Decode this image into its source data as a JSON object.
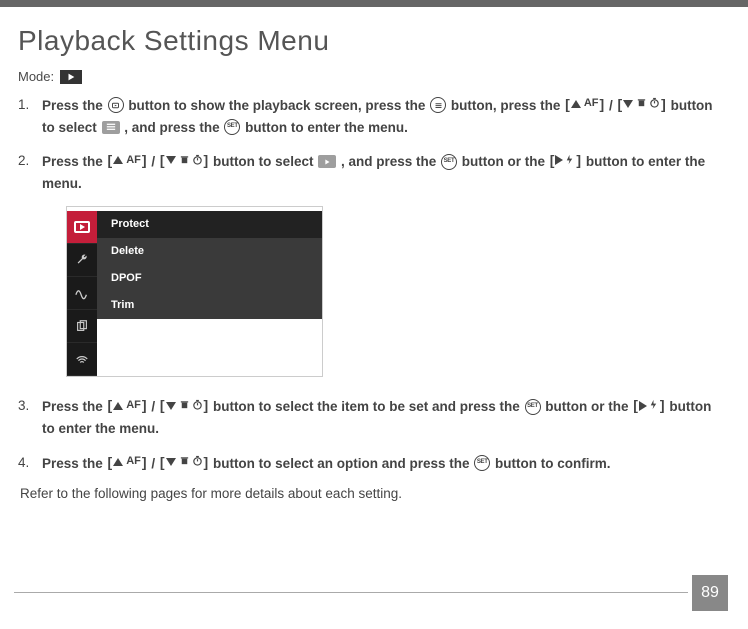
{
  "title": "Playback Settings Menu",
  "mode_label": "Mode:",
  "steps": [
    {
      "parts": {
        "p1": "Press the ",
        "p2": " button to show the playback screen, press the ",
        "p3": " button, press the ",
        "p4": " / ",
        "p5": " button to select ",
        "p6": " , and press the ",
        "p7": " button to enter the menu."
      }
    },
    {
      "parts": {
        "p1": "Press the ",
        "p2": " / ",
        "p3": " button to select ",
        "p4": " , and press the ",
        "p5": " button or the ",
        "p6": " button to enter the menu."
      }
    },
    {
      "parts": {
        "p1": "Press the ",
        "p2": " / ",
        "p3": " button to select the item to be set and press the ",
        "p4": " button or the ",
        "p5": " button to enter the menu."
      }
    },
    {
      "parts": {
        "p1": "Press the ",
        "p2": " / ",
        "p3": " button to select an option and press the ",
        "p4": " button to confirm."
      }
    }
  ],
  "af_label": "AF",
  "set_label": "SET",
  "menu_items": [
    "Protect",
    "Delete",
    "DPOF",
    "Trim"
  ],
  "footer_text": "Refer to the following pages for more details about each setting.",
  "page_number": "89"
}
